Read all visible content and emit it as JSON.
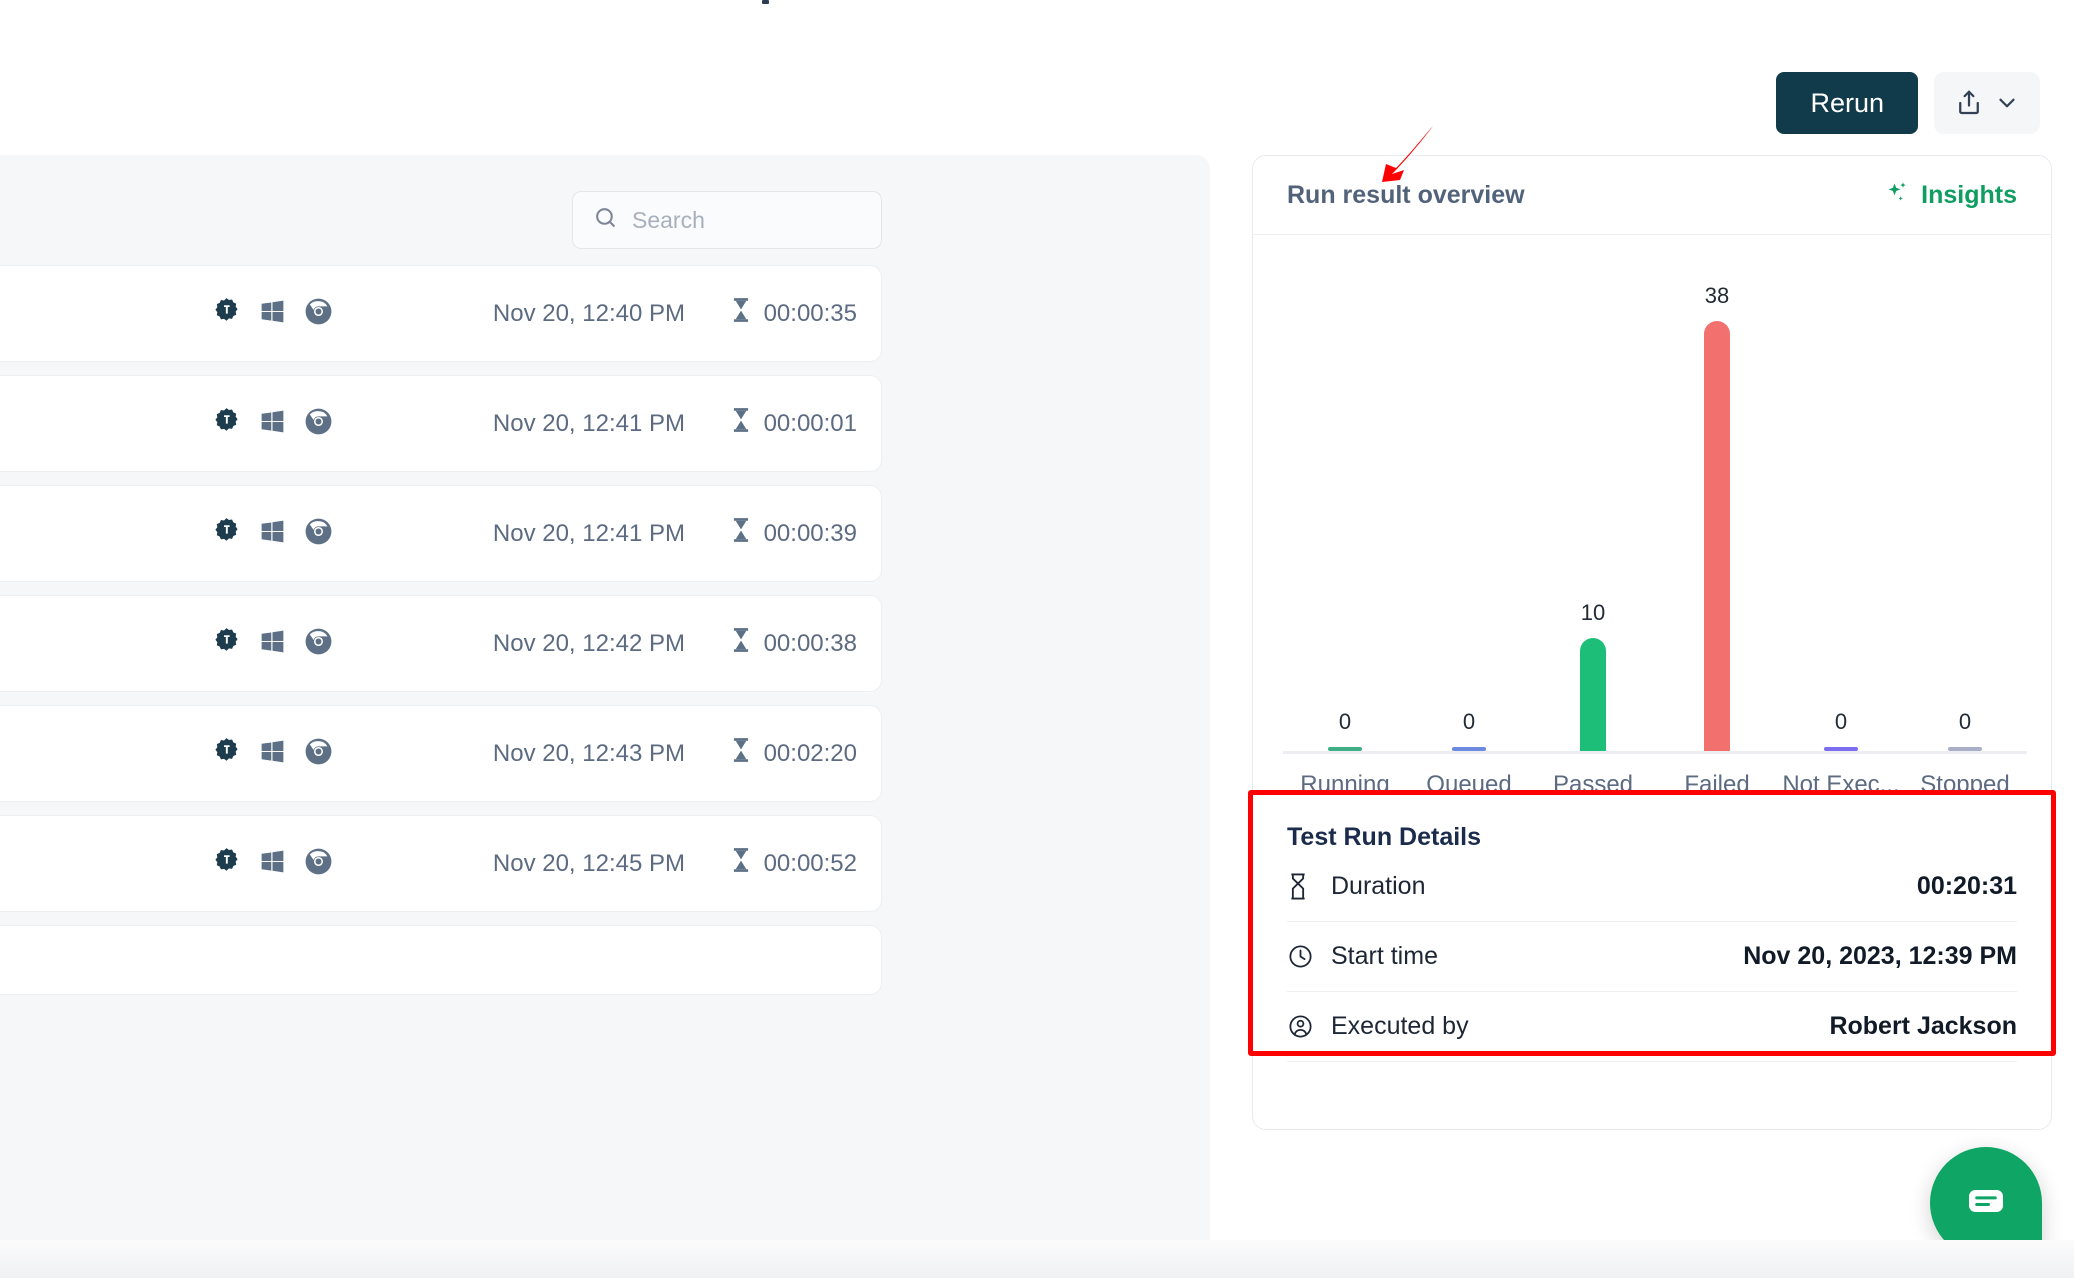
{
  "header": {
    "rerun_label": "Rerun",
    "share_icon": "share-upload-icon",
    "chevron_icon": "chevron-down-icon"
  },
  "list": {
    "search": {
      "placeholder": "Search",
      "value": "",
      "icon": "search-icon"
    },
    "rows": [
      {
        "config_icon": "gear-testim-icon",
        "os_icon": "windows-icon",
        "browser_icon": "chrome-icon",
        "date": "Nov 20, 12:40 PM",
        "duration_icon": "hourglass-icon",
        "duration": "00:00:35"
      },
      {
        "config_icon": "gear-testim-icon",
        "os_icon": "windows-icon",
        "browser_icon": "chrome-icon",
        "date": "Nov 20, 12:41 PM",
        "duration_icon": "hourglass-icon",
        "duration": "00:00:01"
      },
      {
        "config_icon": "gear-testim-icon",
        "os_icon": "windows-icon",
        "browser_icon": "chrome-icon",
        "date": "Nov 20, 12:41 PM",
        "duration_icon": "hourglass-icon",
        "duration": "00:00:39"
      },
      {
        "config_icon": "gear-testim-icon",
        "os_icon": "windows-icon",
        "browser_icon": "chrome-icon",
        "date": "Nov 20, 12:42 PM",
        "duration_icon": "hourglass-icon",
        "duration": "00:00:38"
      },
      {
        "config_icon": "gear-testim-icon",
        "os_icon": "windows-icon",
        "browser_icon": "chrome-icon",
        "date": "Nov 20, 12:43 PM",
        "duration_icon": "hourglass-icon",
        "duration": "00:02:20"
      },
      {
        "config_icon": "gear-testim-icon",
        "os_icon": "windows-icon",
        "browser_icon": "chrome-icon",
        "date": "Nov 20, 12:45 PM",
        "duration_icon": "hourglass-icon",
        "duration": "00:00:52"
      }
    ]
  },
  "overview_card": {
    "title": "Run result overview",
    "insights_label": "Insights",
    "insights_icon": "sparkles-icon",
    "insights_color": "#0f9d62"
  },
  "chart_data": {
    "type": "bar",
    "title": "Run result overview",
    "xlabel": "",
    "ylabel": "",
    "ylim": [
      0,
      38
    ],
    "grid": false,
    "legend": "none",
    "categories": [
      "Running",
      "Queued",
      "Passed",
      "Failed",
      "Not Exec...",
      "Stopped"
    ],
    "values": [
      0,
      0,
      10,
      38,
      0,
      0
    ],
    "value_labels": [
      "0",
      "0",
      "10",
      "38",
      "0",
      "0"
    ],
    "colors": [
      "#3fae84",
      "#6b8ae0",
      "#1dbf78",
      "#f2706e",
      "#7b6cf0",
      "#a9aec9"
    ]
  },
  "details": {
    "title": "Test Run Details",
    "rows": [
      {
        "icon": "hourglass-icon",
        "label": "Duration",
        "value": "00:20:31"
      },
      {
        "icon": "clock-icon",
        "label": "Start time",
        "value": "Nov 20, 2023, 12:39 PM"
      },
      {
        "icon": "user-circle-icon",
        "label": "Executed by",
        "value": "Robert Jackson"
      }
    ]
  },
  "annotations": {
    "arrow_color": "#ff0000",
    "highlight_color": "#ff0000"
  },
  "chat": {
    "icon": "chat-bubble-icon",
    "color": "#0fa564"
  }
}
